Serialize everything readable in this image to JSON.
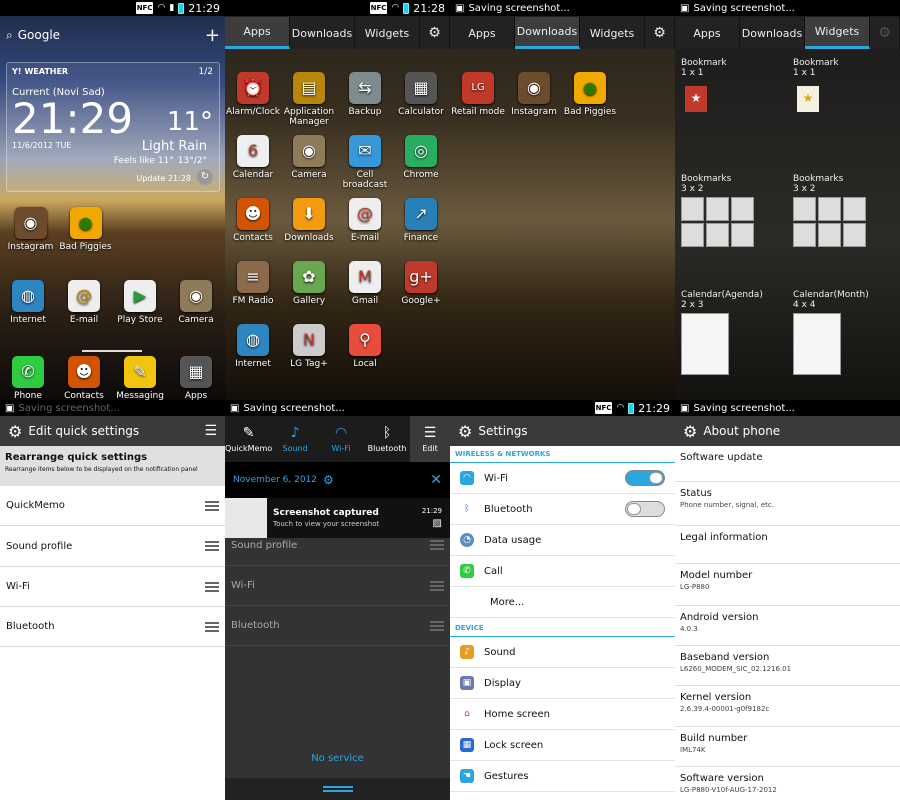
{
  "status": {
    "time_home": "21:29",
    "time_apps": "21:28",
    "time_bottom": "21:29",
    "saving": "Saving screenshot...",
    "nfc": "NFC"
  },
  "home": {
    "search": "Google",
    "weather_brand": "WEATHER",
    "page": "1/2",
    "location": "Current (Novi Sad)",
    "time": "21:29",
    "temp": "11°",
    "date": "11/6/2012 TUE",
    "condition": "Light Rain",
    "feels": "Feels like 11°",
    "hilo": "13°/2°",
    "update": "Update 21:28",
    "apps": [
      {
        "label": "Instagram"
      },
      {
        "label": "Bad Piggies"
      }
    ],
    "row2": [
      {
        "label": "Internet"
      },
      {
        "label": "E-mail"
      },
      {
        "label": "Play Store"
      },
      {
        "label": "Camera"
      }
    ],
    "dock": [
      {
        "label": "Phone"
      },
      {
        "label": "Contacts"
      },
      {
        "label": "Messaging"
      },
      {
        "label": "Apps"
      }
    ]
  },
  "tabs": {
    "apps": "Apps",
    "downloads": "Downloads",
    "widgets": "Widgets"
  },
  "drawer": {
    "apps": [
      {
        "label": "Alarm/Clock",
        "color": "#c0392b",
        "glyph": "⏰"
      },
      {
        "label": "Application Manager",
        "color": "#b8860b",
        "glyph": "▤"
      },
      {
        "label": "Backup",
        "color": "#7f8c8d",
        "glyph": "⇆"
      },
      {
        "label": "Calculator",
        "color": "#555555",
        "glyph": "▦"
      },
      {
        "label": "Calendar",
        "color": "#ecf0f1",
        "glyph": "6"
      },
      {
        "label": "Camera",
        "color": "#8e7b5a",
        "glyph": "◉"
      },
      {
        "label": "Cell broadcast",
        "color": "#3498db",
        "glyph": "✉"
      },
      {
        "label": "Chrome",
        "color": "#27ae60",
        "glyph": "◎"
      },
      {
        "label": "Contacts",
        "color": "#d35400",
        "glyph": "☻"
      },
      {
        "label": "Downloads",
        "color": "#f39c12",
        "glyph": "⬇"
      },
      {
        "label": "E-mail",
        "color": "#eeeeee",
        "glyph": "@"
      },
      {
        "label": "Finance",
        "color": "#2980b9",
        "glyph": "↗"
      },
      {
        "label": "FM Radio",
        "color": "#8b6b4a",
        "glyph": "≡"
      },
      {
        "label": "Gallery",
        "color": "#6aa84f",
        "glyph": "✿"
      },
      {
        "label": "Gmail",
        "color": "#eeeeee",
        "glyph": "M"
      },
      {
        "label": "Google+",
        "color": "#c0392b",
        "glyph": "g+"
      },
      {
        "label": "Internet",
        "color": "#2e86c1",
        "glyph": "◍"
      },
      {
        "label": "LG Tag+",
        "color": "#cccccc",
        "glyph": "N"
      },
      {
        "label": "Local",
        "color": "#e74c3c",
        "glyph": "⚲"
      }
    ]
  },
  "downloads": {
    "apps": [
      {
        "label": "Retail mode"
      },
      {
        "label": "Instagram"
      },
      {
        "label": "Bad Piggies"
      }
    ]
  },
  "widgets": [
    {
      "name": "Bookmark",
      "size": "1 x 1"
    },
    {
      "name": "Bookmark",
      "size": "1 x 1"
    },
    {
      "name": "Bookmarks",
      "size": "3 x 2"
    },
    {
      "name": "Bookmarks",
      "size": "3 x 2"
    },
    {
      "name": "Calendar(Agenda)",
      "size": "2 x 3"
    },
    {
      "name": "Calendar(Month)",
      "size": "4 x 4"
    }
  ],
  "eqs": {
    "title": "Edit quick settings",
    "rearr_title": "Rearrange quick settings",
    "rearr_desc": "Rearrange items below to be displayed on the notification panel",
    "items": [
      "QuickMemo",
      "Sound profile",
      "Wi-Fi",
      "Bluetooth"
    ]
  },
  "notif": {
    "toggles": [
      "QuickMemo",
      "Sound",
      "Wi-Fi",
      "Bluetooth",
      "Edit"
    ],
    "date": "November 6, 2012",
    "ntitle": "Screenshot captured",
    "nsub": "Touch to view your screenshot",
    "ntime": "21:29",
    "bg_items": [
      "Sound profile",
      "Wi-Fi",
      "Bluetooth"
    ],
    "noservice": "No service"
  },
  "settings": {
    "title": "Settings",
    "sec1": "WIRELESS & NETWORKS",
    "sec2": "DEVICE",
    "wireless": [
      "Wi-Fi",
      "Bluetooth",
      "Data usage",
      "Call",
      "More..."
    ],
    "device": [
      "Sound",
      "Display",
      "Home screen",
      "Lock screen",
      "Gestures"
    ]
  },
  "about": {
    "title": "About phone",
    "rows": [
      {
        "t": "Software update",
        "s": ""
      },
      {
        "t": "Status",
        "s": "Phone number, signal, etc."
      },
      {
        "t": "Legal information",
        "s": ""
      },
      {
        "t": "Model number",
        "s": "LG-P880"
      },
      {
        "t": "Android version",
        "s": "4.0.3"
      },
      {
        "t": "Baseband version",
        "s": "L6260_MODEM_SIC_02.1216.01"
      },
      {
        "t": "Kernel version",
        "s": "2.6.39.4-00001-g0f9182c"
      },
      {
        "t": "Build number",
        "s": "IML74K"
      },
      {
        "t": "Software version",
        "s": "LG-P880-V10f-AUG-17-2012"
      }
    ]
  }
}
